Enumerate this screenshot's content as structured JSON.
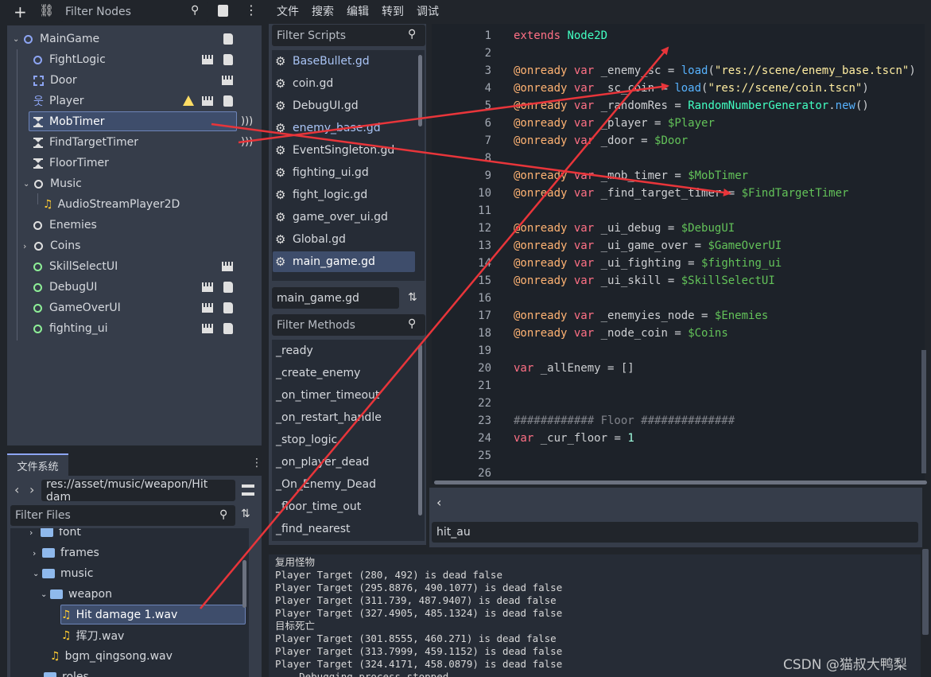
{
  "scene_dock": {
    "filter_placeholder": "Filter Nodes",
    "nodes": [
      {
        "label": "MainGame",
        "icon": "node2d-icon"
      },
      {
        "label": "FightLogic",
        "icon": "node2d-icon"
      },
      {
        "label": "Door",
        "icon": "area-icon"
      },
      {
        "label": "Player",
        "icon": "character-icon"
      },
      {
        "label": "MobTimer",
        "icon": "timer-icon"
      },
      {
        "label": "FindTargetTimer",
        "icon": "timer-icon"
      },
      {
        "label": "FloorTimer",
        "icon": "timer-icon"
      },
      {
        "label": "Music",
        "icon": "node-icon"
      },
      {
        "label": "AudioStreamPlayer2D",
        "icon": "audio-icon"
      },
      {
        "label": "Enemies",
        "icon": "node-icon"
      },
      {
        "label": "Coins",
        "icon": "node-icon"
      },
      {
        "label": "SkillSelectUI",
        "icon": "control-icon"
      },
      {
        "label": "DebugUI",
        "icon": "control-icon"
      },
      {
        "label": "GameOverUI",
        "icon": "control-icon"
      },
      {
        "label": "fighting_ui",
        "icon": "control-icon"
      }
    ]
  },
  "filesystem": {
    "tab_label": "文件系统",
    "path": "res://asset/music/weapon/Hit dam",
    "filter_placeholder": "Filter Files",
    "items": [
      {
        "label": "font"
      },
      {
        "label": "frames"
      },
      {
        "label": "music"
      },
      {
        "label": "weapon"
      },
      {
        "label": "Hit damage 1.wav"
      },
      {
        "label": "挥刀.wav"
      },
      {
        "label": "bgm_qingsong.wav"
      },
      {
        "label": "roles"
      }
    ]
  },
  "menu": {
    "items": [
      "文件",
      "搜索",
      "编辑",
      "转到",
      "调试"
    ]
  },
  "scripts_panel": {
    "filter_placeholder": "Filter Scripts",
    "scripts": [
      "BaseBullet.gd",
      "coin.gd",
      "DebugUI.gd",
      "enemy_base.gd",
      "EventSingleton.gd",
      "fighting_ui.gd",
      "fight_logic.gd",
      "game_over_ui.gd",
      "Global.gd",
      "main_game.gd"
    ],
    "current_script": "main_game.gd",
    "methods_placeholder": "Filter Methods",
    "methods": [
      "_ready",
      "_create_enemy",
      "_on_timer_timeout",
      "_on_restart_handle",
      "_stop_logic",
      "_on_player_dead",
      "_On_Enemy_Dead",
      "_floor_time_out",
      "_find_nearest"
    ]
  },
  "editor": {
    "line_numbers": [
      "1",
      "2",
      "3",
      "4",
      "5",
      "6",
      "7",
      "8",
      "9",
      "10",
      "11",
      "12",
      "13",
      "14",
      "15",
      "16",
      "17",
      "18",
      "19",
      "20",
      "21",
      "22",
      "23",
      "24",
      "25",
      "26"
    ],
    "lines": [
      [
        [
          "kw",
          "extends"
        ],
        [
          "txt",
          " "
        ],
        [
          "ty",
          "Node2D"
        ]
      ],
      [],
      [
        [
          "an",
          "@onready"
        ],
        [
          "txt",
          " "
        ],
        [
          "kw",
          "var"
        ],
        [
          "txt",
          " _enemy_sc = "
        ],
        [
          "fn",
          "load"
        ],
        [
          "txt",
          "("
        ],
        [
          "str",
          "\"res://scene/enemy_base.tscn\""
        ],
        [
          "txt",
          ")"
        ]
      ],
      [
        [
          "an",
          "@onready"
        ],
        [
          "txt",
          " "
        ],
        [
          "kw",
          "var"
        ],
        [
          "txt",
          " _sc_coin = "
        ],
        [
          "fn",
          "load"
        ],
        [
          "txt",
          "("
        ],
        [
          "str",
          "\"res://scene/coin.tscn\""
        ],
        [
          "txt",
          ")"
        ]
      ],
      [
        [
          "an",
          "@onready"
        ],
        [
          "txt",
          " "
        ],
        [
          "kw",
          "var"
        ],
        [
          "txt",
          " _randomRes = "
        ],
        [
          "ty",
          "RandomNumberGenerator"
        ],
        [
          "txt",
          "."
        ],
        [
          "fn",
          "new"
        ],
        [
          "txt",
          "()"
        ]
      ],
      [
        [
          "an",
          "@onready"
        ],
        [
          "txt",
          " "
        ],
        [
          "kw",
          "var"
        ],
        [
          "txt",
          " _player = "
        ],
        [
          "np",
          "$Player"
        ]
      ],
      [
        [
          "an",
          "@onready"
        ],
        [
          "txt",
          " "
        ],
        [
          "kw",
          "var"
        ],
        [
          "txt",
          " _door = "
        ],
        [
          "np",
          "$Door"
        ]
      ],
      [],
      [
        [
          "an",
          "@onready"
        ],
        [
          "txt",
          " "
        ],
        [
          "kw",
          "var"
        ],
        [
          "txt",
          " _mob_timer = "
        ],
        [
          "np",
          "$MobTimer"
        ]
      ],
      [
        [
          "an",
          "@onready"
        ],
        [
          "txt",
          " "
        ],
        [
          "kw",
          "var"
        ],
        [
          "txt",
          " _find_target_timer = "
        ],
        [
          "np",
          "$FindTargetTimer"
        ]
      ],
      [],
      [
        [
          "an",
          "@onready"
        ],
        [
          "txt",
          " "
        ],
        [
          "kw",
          "var"
        ],
        [
          "txt",
          " _ui_debug = "
        ],
        [
          "np",
          "$DebugUI"
        ]
      ],
      [
        [
          "an",
          "@onready"
        ],
        [
          "txt",
          " "
        ],
        [
          "kw",
          "var"
        ],
        [
          "txt",
          " _ui_game_over = "
        ],
        [
          "np",
          "$GameOverUI"
        ]
      ],
      [
        [
          "an",
          "@onready"
        ],
        [
          "txt",
          " "
        ],
        [
          "kw",
          "var"
        ],
        [
          "txt",
          " _ui_fighting = "
        ],
        [
          "np",
          "$fighting_ui"
        ]
      ],
      [
        [
          "an",
          "@onready"
        ],
        [
          "txt",
          " "
        ],
        [
          "kw",
          "var"
        ],
        [
          "txt",
          " _ui_skill = "
        ],
        [
          "np",
          "$SkillSelectUI"
        ]
      ],
      [],
      [
        [
          "an",
          "@onready"
        ],
        [
          "txt",
          " "
        ],
        [
          "kw",
          "var"
        ],
        [
          "txt",
          " _enemyies_node = "
        ],
        [
          "np",
          "$Enemies"
        ]
      ],
      [
        [
          "an",
          "@onready"
        ],
        [
          "txt",
          " "
        ],
        [
          "kw",
          "var"
        ],
        [
          "txt",
          " _node_coin = "
        ],
        [
          "np",
          "$Coins"
        ]
      ],
      [],
      [
        [
          "kw",
          "var"
        ],
        [
          "txt",
          " _allEnemy = []"
        ]
      ],
      [],
      [],
      [
        [
          "cm",
          "############ Floor ##############"
        ]
      ],
      [
        [
          "kw",
          "var"
        ],
        [
          "txt",
          " _cur_floor = "
        ],
        [
          "nm",
          "1"
        ]
      ],
      [],
      []
    ],
    "search_value": "hit_au"
  },
  "output": {
    "lines": [
      "复用怪物",
      "Player Target (280, 492) is dead false",
      "Player Target (295.8876, 490.1077) is dead false",
      "Player Target (311.739, 487.9407) is dead false",
      "Player Target (327.4905, 485.1324) is dead false",
      "目标死亡",
      "Player Target (301.8555, 460.271) is dead false",
      "Player Target (313.7999, 459.1152) is dead false",
      "Player Target (324.4171, 458.0879) is dead false",
      "--- Debugging process stopped ---"
    ]
  },
  "watermark": "CSDN @猫叔大鸭梨",
  "colors": {
    "arrow": "#e8353a",
    "selection": "#3e4d6b",
    "accent": "#8da5f3"
  }
}
